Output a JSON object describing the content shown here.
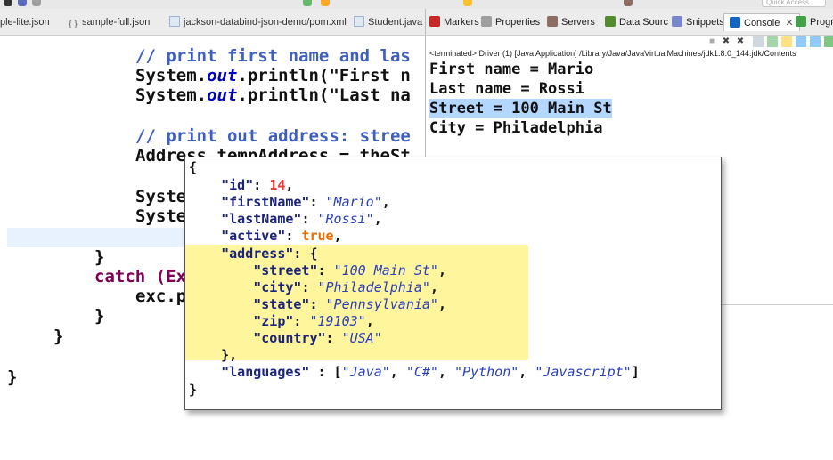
{
  "toolbar": {
    "quick_access": "Quick Access"
  },
  "editor_tabs": [
    {
      "label": "ple-lite.json",
      "icon": "json-file-icon"
    },
    {
      "label": "sample-full.json",
      "icon": "json-braces-icon"
    },
    {
      "label": "jackson-databind-json-demo/pom.xml",
      "icon": "xml-file-icon"
    },
    {
      "label": "Student.java",
      "icon": "java-file-icon"
    }
  ],
  "view_tabs": [
    {
      "label": "Markers",
      "icon": "markers-icon",
      "color": "#c62828"
    },
    {
      "label": "Properties",
      "icon": "properties-icon",
      "color": "#6d6d6d"
    },
    {
      "label": "Servers",
      "icon": "servers-icon",
      "color": "#8d6e63"
    },
    {
      "label": "Data Sourc",
      "icon": "data-source-icon",
      "color": "#558b2f"
    },
    {
      "label": "Snippets",
      "icon": "snippets-icon",
      "color": "#7986cb"
    },
    {
      "label": "Console",
      "icon": "console-icon",
      "color": "#1565c0",
      "active": true,
      "close": "✕"
    },
    {
      "label": "Progress",
      "icon": "progress-icon",
      "color": "#43a047"
    }
  ],
  "editor": {
    "lines": {
      "c1": "// print first name and las",
      "l2a": "System.",
      "l2b": "out",
      "l2c": ".println(\"First n",
      "l3a": "System.",
      "l3b": "out",
      "l3c": ".println(\"Last na",
      "c4": "// print out address: stree",
      "l5": "Address tempAddress = theSt",
      "l6": "Syste",
      "l7": "Syste",
      "l8": "}",
      "l9": "catch (Ex",
      "l10": "exc.p",
      "l11": "}",
      "l12": "}",
      "l13": "}"
    }
  },
  "console": {
    "terminated": "<terminated> Driver (1) [Java Application] /Library/Java/JavaVirtualMachines/jdk1.8.0_144.jdk/Contents",
    "output": [
      "First name = Mario",
      "Last name = Rossi",
      "Street = 100 Main St",
      "City = Philadelphia"
    ]
  },
  "json_popup": {
    "open": "{",
    "close": "}",
    "id_key": "\"id\"",
    "id_val": "14",
    "first_key": "\"firstName\"",
    "first_val": "\"Mario\"",
    "last_key": "\"lastName\"",
    "last_val": "\"Rossi\"",
    "active_key": "\"active\"",
    "active_val": "true",
    "address_key": "\"address\"",
    "street_key": "\"street\"",
    "street_val": "\"100 Main St\"",
    "city_key": "\"city\"",
    "city_val": "\"Philadelphia\"",
    "state_key": "\"state\"",
    "state_val": "\"Pennsylvania\"",
    "zip_key": "\"zip\"",
    "zip_val": "\"19103\"",
    "country_key": "\"country\"",
    "country_val": "\"USA\"",
    "address_close": "},",
    "languages_key": "\"languages\"",
    "lang1": "\"Java\"",
    "lang2": "\"C#\"",
    "lang3": "\"Python\"",
    "lang4": "\"Javascript\""
  }
}
